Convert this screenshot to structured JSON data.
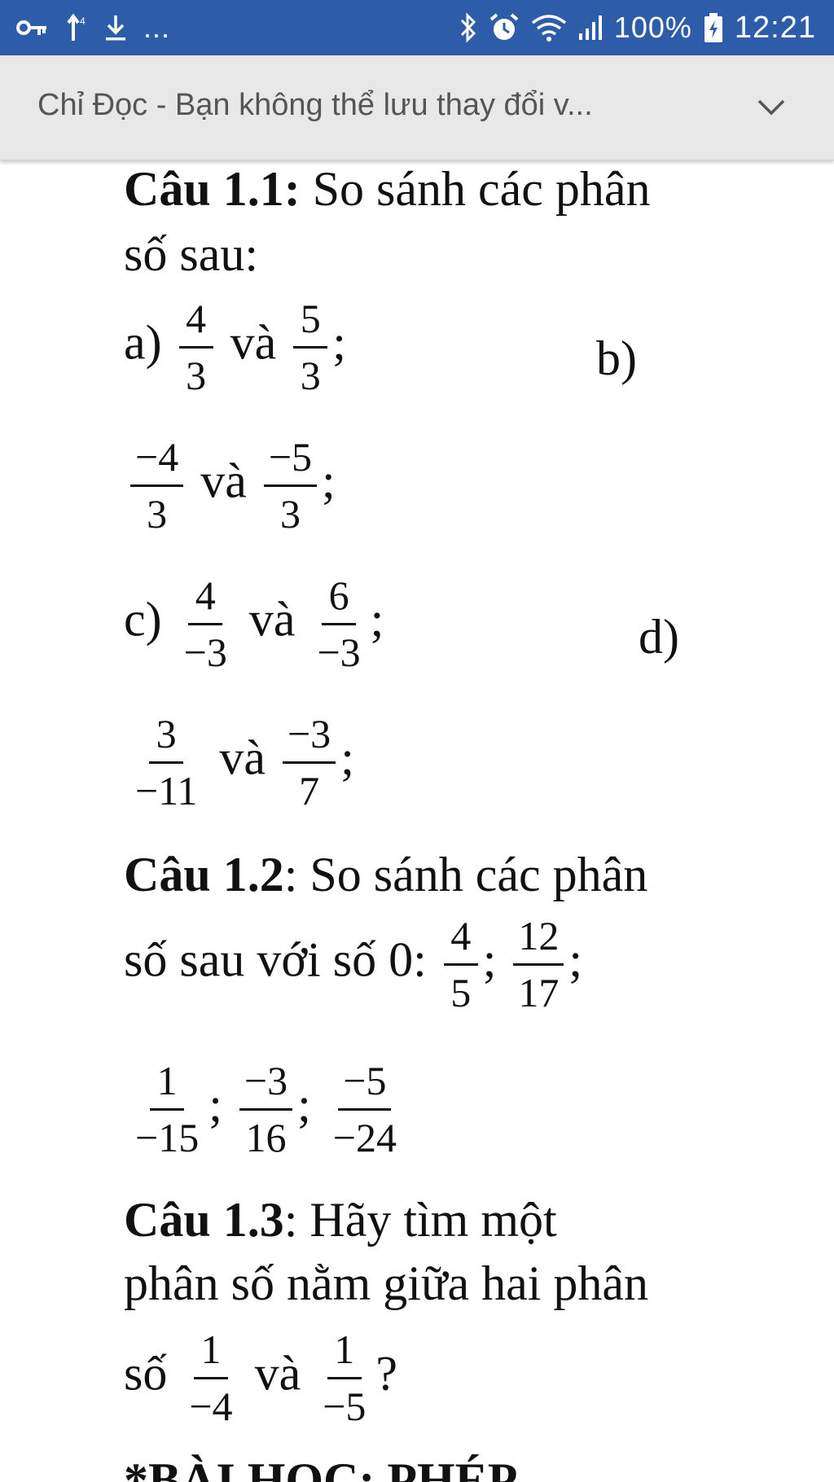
{
  "status_bar": {
    "icons_left": [
      "key-icon",
      "data-arrows-icon",
      "download-icon"
    ],
    "more": "...",
    "icons_right": [
      "bluetooth-icon",
      "alarm-icon",
      "wifi-icon",
      "signal-icon"
    ],
    "battery": "100%",
    "time": "12:21",
    "color": "#2d5da8"
  },
  "banner": {
    "text": "Chỉ Đọc - Bạn không thể lưu thay đổi v...",
    "background": "#e8e8e8"
  },
  "document": {
    "q11": {
      "label": "Câu 1.1:",
      "text1": " So sánh các phân",
      "text2": "số sau:",
      "a_label": "a)",
      "a1": {
        "num": "4",
        "den": "3"
      },
      "a2": {
        "num": "5",
        "den": "3"
      },
      "b_label": "b)",
      "b1": {
        "num": "−4",
        "den": "3"
      },
      "b2": {
        "num": "−5",
        "den": "3"
      },
      "c_label": "c)",
      "c1": {
        "num": "4",
        "den": "−3"
      },
      "c2": {
        "num": "6",
        "den": "−3"
      },
      "d_label": "d)",
      "d1": {
        "num": "3",
        "den": "−11"
      },
      "d2": {
        "num": "−3",
        "den": "7"
      },
      "and": "và",
      "semicolon": ";"
    },
    "q12": {
      "label": "Câu 1.2",
      "text1": ": So sánh các phân",
      "text2": "số sau với số 0:",
      "f1": {
        "num": "4",
        "den": "5"
      },
      "f2": {
        "num": "12",
        "den": "17"
      },
      "f3": {
        "num": "1",
        "den": "−15"
      },
      "f4": {
        "num": "−3",
        "den": "16"
      },
      "f5": {
        "num": "−5",
        "den": "−24"
      },
      "semicolon": ";"
    },
    "q13": {
      "label": "Câu 1.3",
      "text1": ": Hãy tìm một",
      "text2": "phân số nằm giữa hai phân",
      "text3": "số",
      "f1": {
        "num": "1",
        "den": "−4"
      },
      "f2": {
        "num": "1",
        "den": "−5"
      },
      "and": "và",
      "question": "?"
    },
    "footer_partial": "*BÀI HỌC: PHÉP"
  }
}
